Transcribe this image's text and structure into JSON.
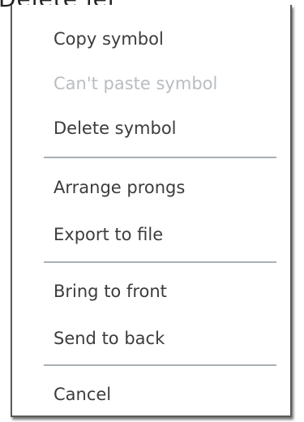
{
  "background_text": "Delete ler",
  "menu": {
    "items": [
      {
        "label": "Copy symbol",
        "enabled": true
      },
      {
        "label": "Can't paste symbol",
        "enabled": false
      },
      {
        "label": "Delete symbol",
        "enabled": true
      },
      {
        "label": "Arrange prongs",
        "enabled": true
      },
      {
        "label": "Export to file",
        "enabled": true
      },
      {
        "label": "Bring to front",
        "enabled": true
      },
      {
        "label": "Send to back",
        "enabled": true
      },
      {
        "label": "Cancel",
        "enabled": true
      }
    ]
  },
  "colors": {
    "text": "#3c3c3c",
    "disabled_text": "#b9bdc1",
    "divider": "#a9b0b6",
    "border": "#5a5a5a"
  }
}
